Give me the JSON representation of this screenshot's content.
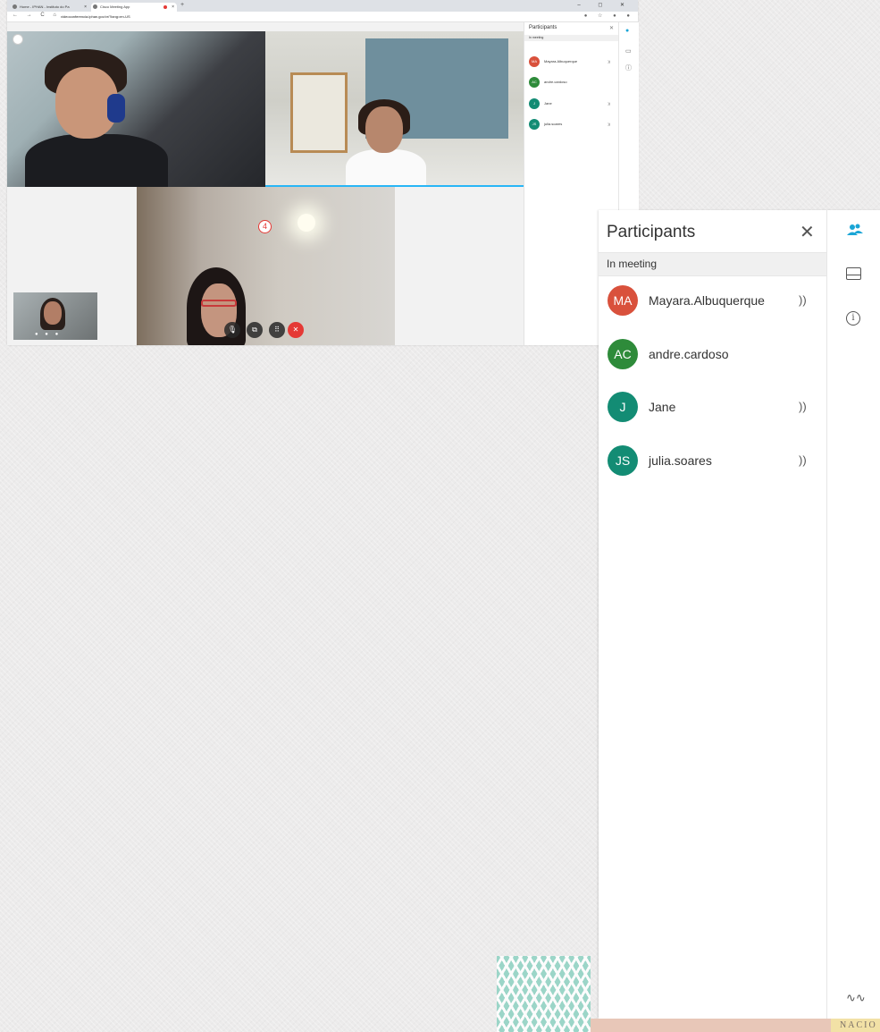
{
  "browser": {
    "tabs": [
      {
        "label": "Home - IPHAN - Instituto do Pa",
        "active": false
      },
      {
        "label": "Cisco Meeting App",
        "active": true,
        "recording": true
      }
    ],
    "new_tab": "+",
    "window_controls": "– ◻ ✕",
    "nav": "← → C ⌂",
    "url": "videoconferencia.iphan.gov.br/?lang=en-US",
    "extensions": "● ☆ ● ●"
  },
  "meeting": {
    "controls": {
      "mic": "🎙",
      "share": "⧉",
      "keypad": "⠿",
      "end": "✕"
    },
    "selfview_controls": "● ● ●"
  },
  "mini_panel": {
    "title": "Participants",
    "close": "✕",
    "section": "In meeting"
  },
  "panel": {
    "title": "Participants",
    "close": "✕",
    "section": "In meeting",
    "participants": [
      {
        "initials": "MA",
        "name": "Mayara.Albuquerque",
        "speaker": "))",
        "color": "#d9513c"
      },
      {
        "initials": "AC",
        "name": "andre.cardoso",
        "speaker": "",
        "color": "#2e8b3a"
      },
      {
        "initials": "J",
        "name": "Jane",
        "speaker": "))",
        "color": "#138c74"
      },
      {
        "initials": "JS",
        "name": "julia.soares",
        "speaker": "))",
        "color": "#138c74"
      }
    ]
  },
  "rail": {
    "people_icon": "people-icon",
    "participant_count": "4",
    "layout_icon": "layout-icon",
    "info_icon": "info-icon",
    "info_glyph": "i",
    "stats_icon": "stats-icon",
    "stats_glyph": "∿∿"
  },
  "logo": {
    "word": "NACIO"
  },
  "colors": {
    "accent": "#1aa5d6",
    "end_call": "#e53935",
    "badge": "#e53935"
  }
}
